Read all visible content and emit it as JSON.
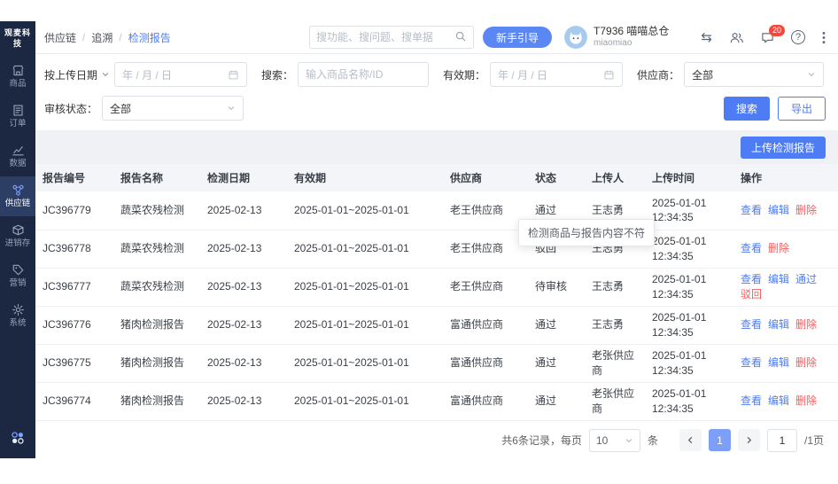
{
  "colors": {
    "accent": "#4e7cf5",
    "danger": "#f25c5c",
    "sidebar_bg": "#1c2742",
    "badge_red": "#f5483d"
  },
  "sidebar": {
    "logo": "观麦科技",
    "items": [
      {
        "id": "goods",
        "label": "商品",
        "icon": "store-icon",
        "active": false
      },
      {
        "id": "orders",
        "label": "订单",
        "icon": "order-doc-icon",
        "active": false
      },
      {
        "id": "data",
        "label": "数据",
        "icon": "chart-icon",
        "active": false
      },
      {
        "id": "supply-chain",
        "label": "供应链",
        "icon": "supply-chain-icon",
        "active": true
      },
      {
        "id": "inventory",
        "label": "进销存",
        "icon": "inventory-box-icon",
        "active": false
      },
      {
        "id": "marketing",
        "label": "营销",
        "icon": "tag-icon",
        "active": false
      },
      {
        "id": "system",
        "label": "系统",
        "icon": "gear-icon",
        "active": false
      }
    ]
  },
  "topbar": {
    "breadcrumb": [
      "供应链",
      "追溯",
      "检测报告"
    ],
    "search_placeholder": "搜功能、搜问题、搜单据",
    "guide_button": "新手引导",
    "user": {
      "name": "T7936 喵喵总仓",
      "subtitle": "miaomiao"
    },
    "message_badge": "20",
    "help_label": "?"
  },
  "filters": {
    "date_type_label": "按上传日期",
    "upload_date_placeholder": "年 / 月 / 日",
    "search_label": "搜索：",
    "search_placeholder": "输入商品名称/ID",
    "validity_label": "有效期：",
    "validity_placeholder": "年 / 月 / 日",
    "supplier_label": "供应商：",
    "supplier_value": "全部",
    "audit_label": "审核状态：",
    "audit_value": "全部",
    "search_button": "搜索",
    "export_button": "导出"
  },
  "toolbar": {
    "upload_button": "上传检测报告"
  },
  "table": {
    "headers": [
      "报告编号",
      "报告名称",
      "检测日期",
      "有效期",
      "供应商",
      "状态",
      "上传人",
      "上传时间",
      "操作"
    ],
    "rows": [
      {
        "id": "JC396779",
        "name": "蔬菜农残检测",
        "date": "2025-02-13",
        "validity": "2025-01-01~2025-01-01",
        "supplier": "老王供应商",
        "status": "通过",
        "uploader": "王志勇",
        "time": "2025-01-01 12:34:35",
        "actions": [
          {
            "label": "查看",
            "action": "view",
            "style": "link"
          },
          {
            "label": "编辑",
            "action": "edit",
            "style": "link"
          },
          {
            "label": "删除",
            "action": "delete",
            "style": "danger"
          }
        ]
      },
      {
        "id": "JC396778",
        "name": "蔬菜农残检测",
        "date": "2025-02-13",
        "validity": "2025-01-01~2025-01-01",
        "supplier": "老王供应商",
        "status": "驳回",
        "uploader": "王志勇",
        "time": "2025-01-01 12:34:35",
        "actions": [
          {
            "label": "查看",
            "action": "view",
            "style": "link"
          },
          {
            "label": "删除",
            "action": "delete",
            "style": "danger"
          }
        ]
      },
      {
        "id": "JC396777",
        "name": "蔬菜农残检测",
        "date": "2025-02-13",
        "validity": "2025-01-01~2025-01-01",
        "supplier": "老王供应商",
        "status": "待审核",
        "uploader": "王志勇",
        "time": "2025-01-01 12:34:35",
        "actions": [
          {
            "label": "查看",
            "action": "view",
            "style": "link"
          },
          {
            "label": "编辑",
            "action": "edit",
            "style": "link"
          },
          {
            "label": "通过",
            "action": "approve",
            "style": "link"
          },
          {
            "label": "驳回",
            "action": "reject",
            "style": "danger"
          }
        ]
      },
      {
        "id": "JC396776",
        "name": "猪肉检测报告",
        "date": "2025-02-13",
        "validity": "2025-01-01~2025-01-01",
        "supplier": "富通供应商",
        "status": "通过",
        "uploader": "王志勇",
        "time": "2025-01-01 12:34:35",
        "actions": [
          {
            "label": "查看",
            "action": "view",
            "style": "link"
          },
          {
            "label": "编辑",
            "action": "edit",
            "style": "link"
          },
          {
            "label": "删除",
            "action": "delete",
            "style": "danger"
          }
        ]
      },
      {
        "id": "JC396775",
        "name": "猪肉检测报告",
        "date": "2025-02-13",
        "validity": "2025-01-01~2025-01-01",
        "supplier": "富通供应商",
        "status": "通过",
        "uploader": "老张供应商",
        "time": "2025-01-01 12:34:35",
        "actions": [
          {
            "label": "查看",
            "action": "view",
            "style": "link"
          },
          {
            "label": "编辑",
            "action": "edit",
            "style": "link"
          },
          {
            "label": "删除",
            "action": "delete",
            "style": "danger"
          }
        ]
      },
      {
        "id": "JC396774",
        "name": "猪肉检测报告",
        "date": "2025-02-13",
        "validity": "2025-01-01~2025-01-01",
        "supplier": "富通供应商",
        "status": "通过",
        "uploader": "老张供应商",
        "time": "2025-01-01 12:34:35",
        "actions": [
          {
            "label": "查看",
            "action": "view",
            "style": "link"
          },
          {
            "label": "编辑",
            "action": "edit",
            "style": "link"
          },
          {
            "label": "删除",
            "action": "delete",
            "style": "danger"
          }
        ]
      }
    ]
  },
  "tooltip": {
    "text": "检测商品与报告内容不符"
  },
  "pagination": {
    "summary": "共6条记录，每页",
    "page_size": "10",
    "unit": "条",
    "current_page": "1",
    "jump_value": "1",
    "page_suffix": "/1页"
  }
}
